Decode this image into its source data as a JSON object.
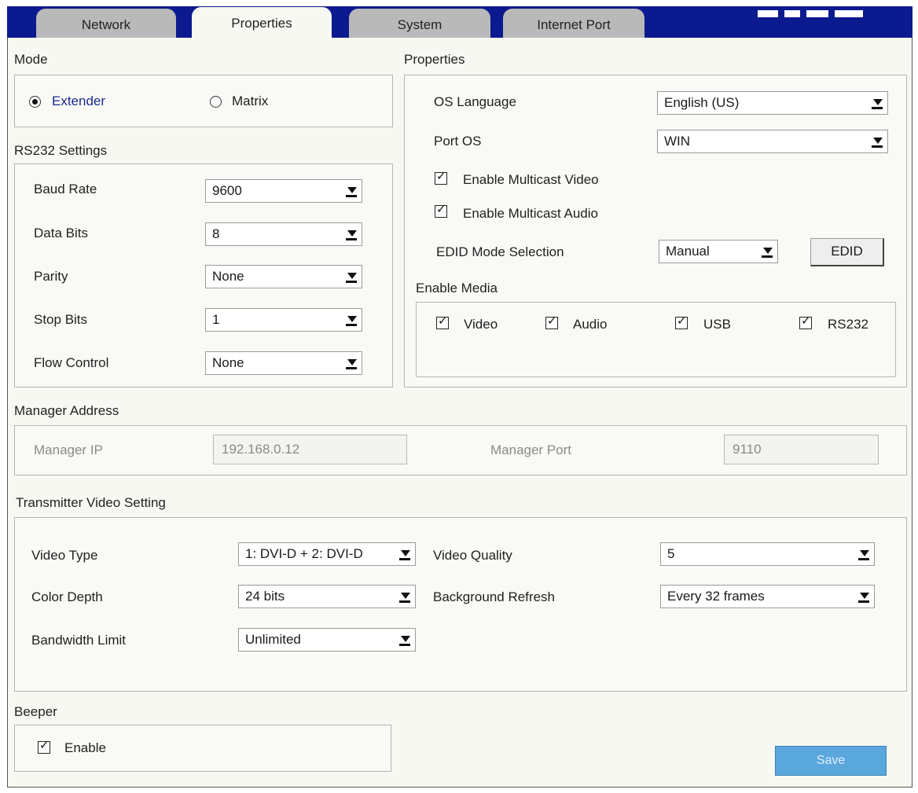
{
  "tabs": [
    "Network",
    "Properties",
    "System",
    "Internet Port"
  ],
  "mode": {
    "title": "Mode",
    "options": [
      "Extender",
      "Matrix"
    ],
    "selected": "Extender"
  },
  "rs232": {
    "title": "RS232 Settings",
    "fields": [
      {
        "label": "Baud Rate",
        "value": "9600"
      },
      {
        "label": "Data Bits",
        "value": "8"
      },
      {
        "label": "Parity",
        "value": "None"
      },
      {
        "label": "Stop Bits",
        "value": "1"
      },
      {
        "label": "Flow Control",
        "value": "None"
      }
    ]
  },
  "properties": {
    "title": "Properties",
    "os_language_label": "OS Language",
    "os_language_value": "English (US)",
    "port_os_label": "Port OS",
    "port_os_value": "WIN",
    "multicast_video_label": "Enable Multicast Video",
    "multicast_audio_label": "Enable Multicast Audio",
    "edid_label": "EDID Mode Selection",
    "edid_value": "Manual",
    "edid_button": "EDID"
  },
  "enable_media": {
    "title": "Enable Media",
    "items": [
      "Video",
      "Audio",
      "USB",
      "RS232"
    ]
  },
  "manager": {
    "title": "Manager Address",
    "ip_label": "Manager IP",
    "ip_value": "192.168.0.12",
    "port_label": "Manager Port",
    "port_value": "9110"
  },
  "video": {
    "title": "Transmitter Video Setting",
    "video_type_label": "Video Type",
    "video_type_value": "1: DVI-D + 2: DVI-D",
    "color_depth_label": "Color Depth",
    "color_depth_value": "24 bits",
    "bandwidth_label": "Bandwidth Limit",
    "bandwidth_value": "Unlimited",
    "quality_label": "Video Quality",
    "quality_value": "5",
    "refresh_label": "Background Refresh",
    "refresh_value": "Every 32 frames"
  },
  "beeper": {
    "title": "Beeper",
    "enable_label": "Enable"
  },
  "save_label": "Save",
  "colors": {
    "header_bar": "#0b1a8e",
    "save_button": "#5aa7de"
  }
}
